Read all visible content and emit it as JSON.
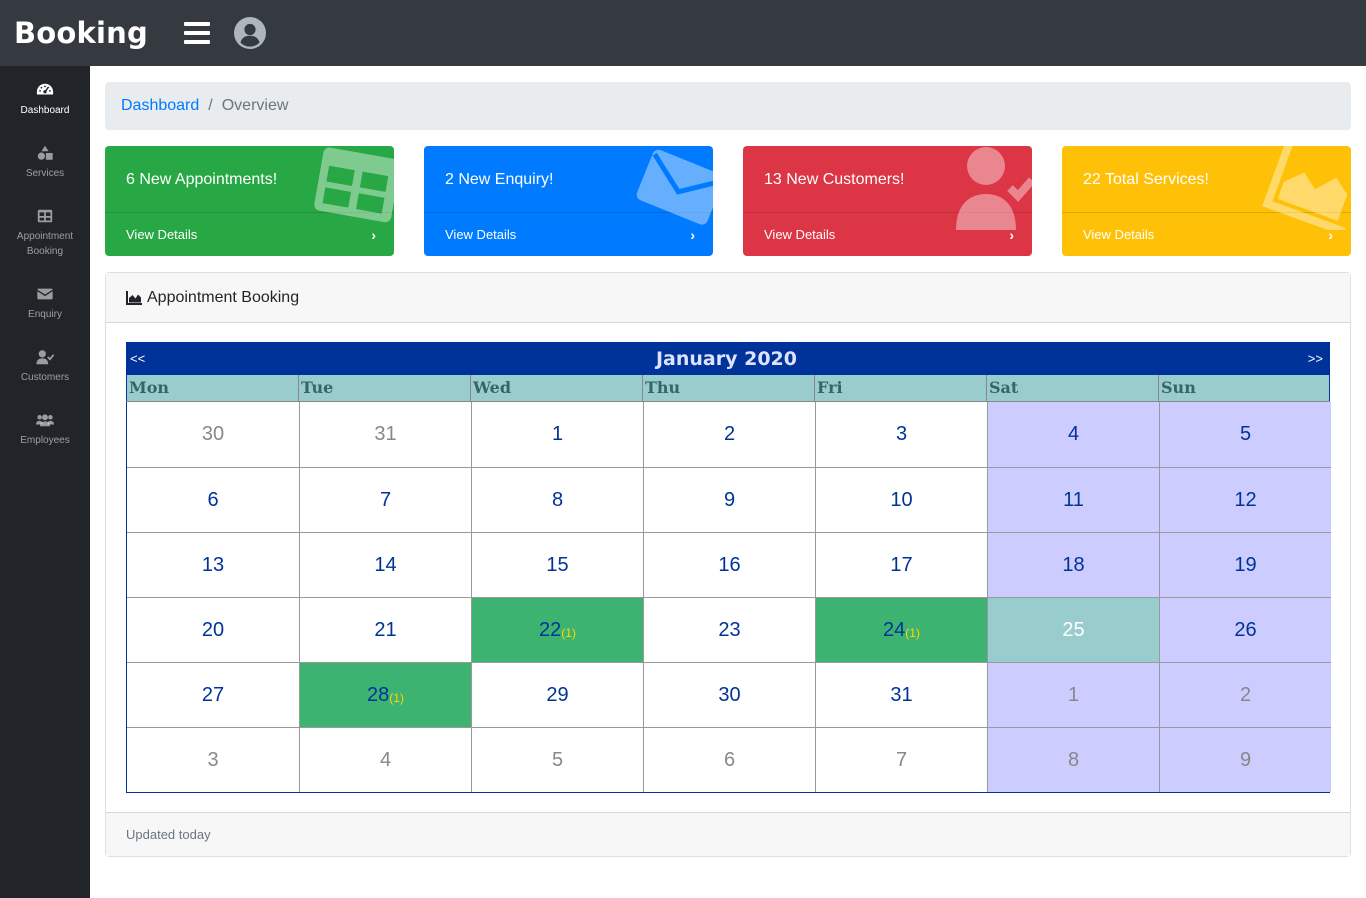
{
  "app": {
    "brand": "Booking"
  },
  "sidebar": {
    "items": [
      {
        "label": "Dashboard",
        "icon": "tachometer-icon",
        "active": true
      },
      {
        "label": "Services",
        "icon": "shapes-icon"
      },
      {
        "label": "Appointment\nBooking",
        "icon": "table-icon"
      },
      {
        "label": "Enquiry",
        "icon": "envelope-icon"
      },
      {
        "label": "Customers",
        "icon": "user-check-icon"
      },
      {
        "label": "Employees",
        "icon": "users-icon"
      }
    ]
  },
  "breadcrumb": {
    "link": "Dashboard",
    "separator": "/",
    "current": "Overview"
  },
  "cards": [
    {
      "title": "6 New Appointments!",
      "footer": "View Details",
      "color": "#28a745",
      "icon": "table-icon"
    },
    {
      "title": "2 New Enquiry!",
      "footer": "View Details",
      "color": "#007bff",
      "icon": "envelope-icon"
    },
    {
      "title": "13 New Customers!",
      "footer": "View Details",
      "color": "#dc3545",
      "icon": "user-check-icon"
    },
    {
      "title": "22 Total Services!",
      "footer": "View Details",
      "color": "#ffc107",
      "icon": "area-chart-icon"
    }
  ],
  "panel": {
    "title": "Appointment Booking",
    "footer": "Updated today"
  },
  "calendar": {
    "title": "January 2020",
    "prev": "<<",
    "next": ">>",
    "days": [
      "Mon",
      "Tue",
      "Wed",
      "Thu",
      "Fri",
      "Sat",
      "Sun"
    ],
    "cells": [
      {
        "d": "30",
        "other": true
      },
      {
        "d": "31",
        "other": true
      },
      {
        "d": "1"
      },
      {
        "d": "2"
      },
      {
        "d": "3"
      },
      {
        "d": "4"
      },
      {
        "d": "5"
      },
      {
        "d": "6"
      },
      {
        "d": "7"
      },
      {
        "d": "8"
      },
      {
        "d": "9"
      },
      {
        "d": "10"
      },
      {
        "d": "11"
      },
      {
        "d": "12"
      },
      {
        "d": "13"
      },
      {
        "d": "14"
      },
      {
        "d": "15"
      },
      {
        "d": "16"
      },
      {
        "d": "17"
      },
      {
        "d": "18"
      },
      {
        "d": "19"
      },
      {
        "d": "20"
      },
      {
        "d": "21"
      },
      {
        "d": "22",
        "booked": true,
        "count": "(1)"
      },
      {
        "d": "23"
      },
      {
        "d": "24",
        "booked": true,
        "count": "(1)"
      },
      {
        "d": "25",
        "today": true
      },
      {
        "d": "26"
      },
      {
        "d": "27"
      },
      {
        "d": "28",
        "booked": true,
        "count": "(1)"
      },
      {
        "d": "29"
      },
      {
        "d": "30"
      },
      {
        "d": "31"
      },
      {
        "d": "1",
        "other": true
      },
      {
        "d": "2",
        "other": true
      },
      {
        "d": "3",
        "other": true
      },
      {
        "d": "4",
        "other": true
      },
      {
        "d": "5",
        "other": true
      },
      {
        "d": "6",
        "other": true
      },
      {
        "d": "7",
        "other": true
      },
      {
        "d": "8",
        "other": true
      },
      {
        "d": "9",
        "other": true
      }
    ]
  }
}
